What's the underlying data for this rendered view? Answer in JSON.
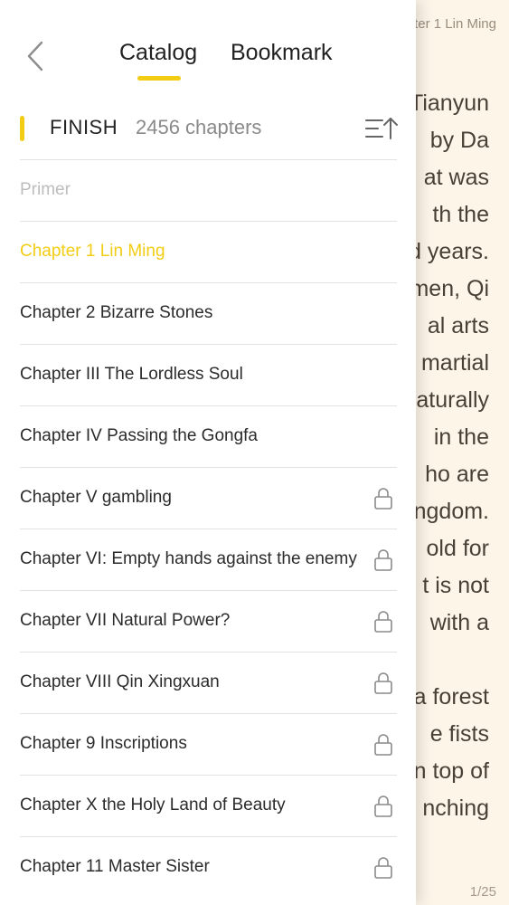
{
  "reader": {
    "header_text": "pter 1 Lin Ming",
    "lines": [
      "Tianyun",
      "by  Da",
      "at  was",
      "th  the",
      "d years.",
      "men, Qi",
      "al  arts",
      "martial",
      "aturally",
      "in  the",
      "ho  are",
      "ngdom.",
      "old  for",
      "t is not",
      "with  a",
      "",
      "a forest",
      "e  fists",
      "n top of",
      "nching"
    ],
    "page_indicator": "1/25",
    "background_color": "#fdf5e8"
  },
  "drawer": {
    "back_icon": "chevron-left-icon",
    "tabs": [
      {
        "label": "Catalog",
        "active": true
      },
      {
        "label": "Bookmark",
        "active": false
      }
    ],
    "status_label": "FINISH",
    "chapter_count": "2456 chapters",
    "sort_icon": "sort-ascending-icon",
    "accent_color": "#f2cd14",
    "items": [
      {
        "label": "Primer",
        "state": "primer",
        "locked": false
      },
      {
        "label": "Chapter 1 Lin Ming",
        "state": "active",
        "locked": false
      },
      {
        "label": "Chapter 2 Bizarre Stones",
        "state": "normal",
        "locked": false
      },
      {
        "label": "Chapter III The Lordless Soul",
        "state": "normal",
        "locked": false
      },
      {
        "label": "Chapter IV Passing the Gongfa",
        "state": "normal",
        "locked": false
      },
      {
        "label": "Chapter V gambling",
        "state": "normal",
        "locked": true
      },
      {
        "label": "Chapter VI: Empty hands against the enemy",
        "state": "normal",
        "locked": true
      },
      {
        "label": "Chapter VII Natural Power?",
        "state": "normal",
        "locked": true
      },
      {
        "label": "Chapter VIII Qin Xingxuan",
        "state": "normal",
        "locked": true
      },
      {
        "label": "Chapter 9 Inscriptions",
        "state": "normal",
        "locked": true
      },
      {
        "label": "Chapter X the Holy Land of Beauty",
        "state": "normal",
        "locked": true
      },
      {
        "label": "Chapter 11 Master Sister",
        "state": "normal",
        "locked": true
      }
    ]
  }
}
